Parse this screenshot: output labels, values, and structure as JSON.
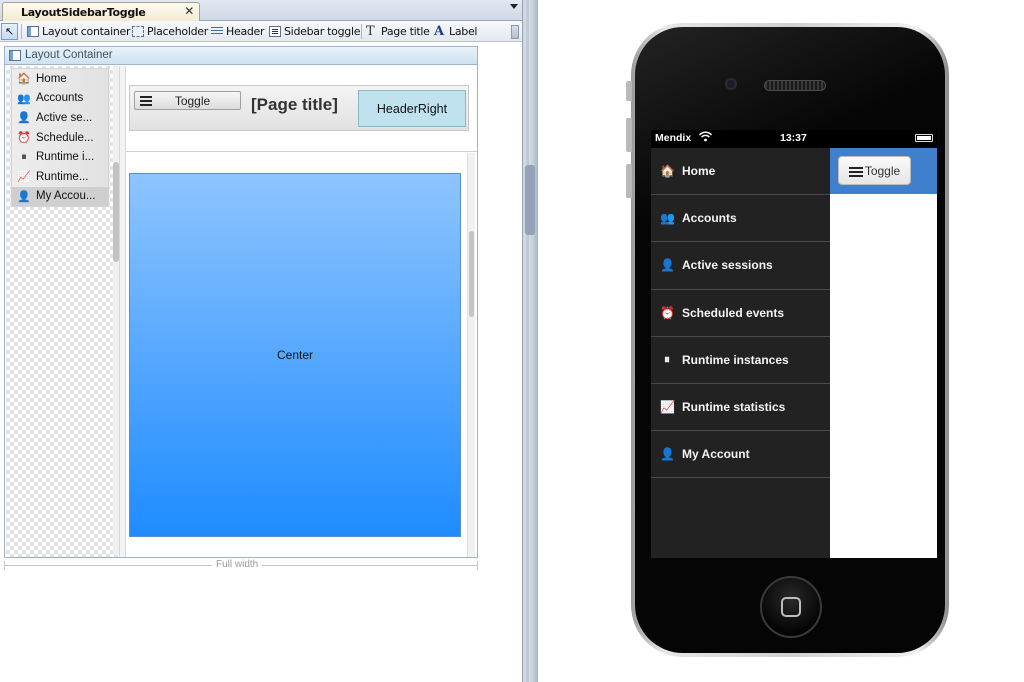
{
  "editor": {
    "tab_title": "LayoutSidebarToggle [Layouts]",
    "tab_close": "✕",
    "toolbar": [
      {
        "label": "Layout container",
        "icon": "layout-container-icon"
      },
      {
        "label": "Placeholder",
        "icon": "placeholder-icon"
      },
      {
        "label": "Header",
        "icon": "header-icon"
      },
      {
        "label": "Sidebar toggle",
        "icon": "sidebar-toggle-icon"
      },
      {
        "label": "Page title",
        "icon": "page-title-icon"
      },
      {
        "label": "Label",
        "icon": "label-icon"
      }
    ],
    "container_label": "Layout Container",
    "sidebar_items": [
      {
        "label": "Home",
        "icon": "🏠"
      },
      {
        "label": "Accounts",
        "icon": "👥"
      },
      {
        "label": "Active se...",
        "icon": "👤"
      },
      {
        "label": "Schedule...",
        "icon": "⏰"
      },
      {
        "label": "Runtime i...",
        "icon": "⏸"
      },
      {
        "label": "Runtime...",
        "icon": "📈"
      },
      {
        "label": "My Accou...",
        "icon": "👤"
      }
    ],
    "toggle_label": "Toggle",
    "page_title": "[Page title]",
    "header_right": "HeaderRight",
    "center_label": "Center",
    "full_width_label": "Full width"
  },
  "phone": {
    "carrier": "Mendix",
    "time": "13:37",
    "menu_items": [
      {
        "label": "Home",
        "icon": "🏠"
      },
      {
        "label": "Accounts",
        "icon": "👥"
      },
      {
        "label": "Active sessions",
        "icon": "👤"
      },
      {
        "label": "Scheduled events",
        "icon": "⏰"
      },
      {
        "label": "Runtime instances",
        "icon": "⏸"
      },
      {
        "label": "Runtime statistics",
        "icon": "📈"
      },
      {
        "label": "My Account",
        "icon": "👤"
      }
    ],
    "toggle_label": "Toggle"
  },
  "colors": {
    "header_blue": "#3f7fcc",
    "menu_dark": "#222222",
    "center_top": "#8ec4ff",
    "center_bottom": "#1e8cff",
    "header_right_bg": "#bfe2ee"
  }
}
